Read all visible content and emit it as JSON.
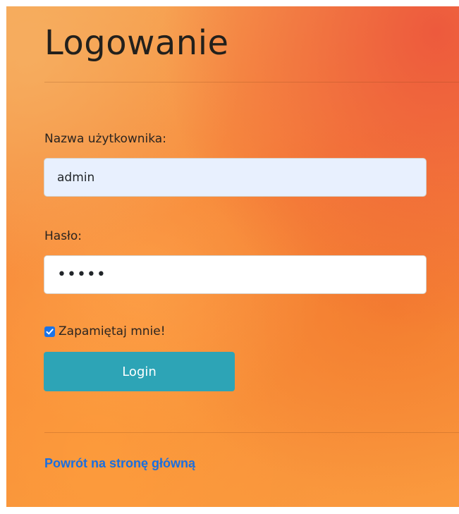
{
  "page": {
    "title": "Logowanie"
  },
  "form": {
    "username_label": "Nazwa użytkownika:",
    "username_value": "admin",
    "password_label": "Hasło:",
    "password_value": "•••••",
    "remember_label": "Zapamiętaj mnie!",
    "remember_checked": true,
    "login_label": "Login"
  },
  "footer": {
    "home_link_label": "Powrót na stronę główną"
  },
  "colors": {
    "login_button": "#2da4b6",
    "link": "#1a6fe0",
    "checkbox": "#1a73e8",
    "autofill_bg": "#e8f0fe"
  },
  "icons": {
    "checkbox": "check-icon"
  }
}
